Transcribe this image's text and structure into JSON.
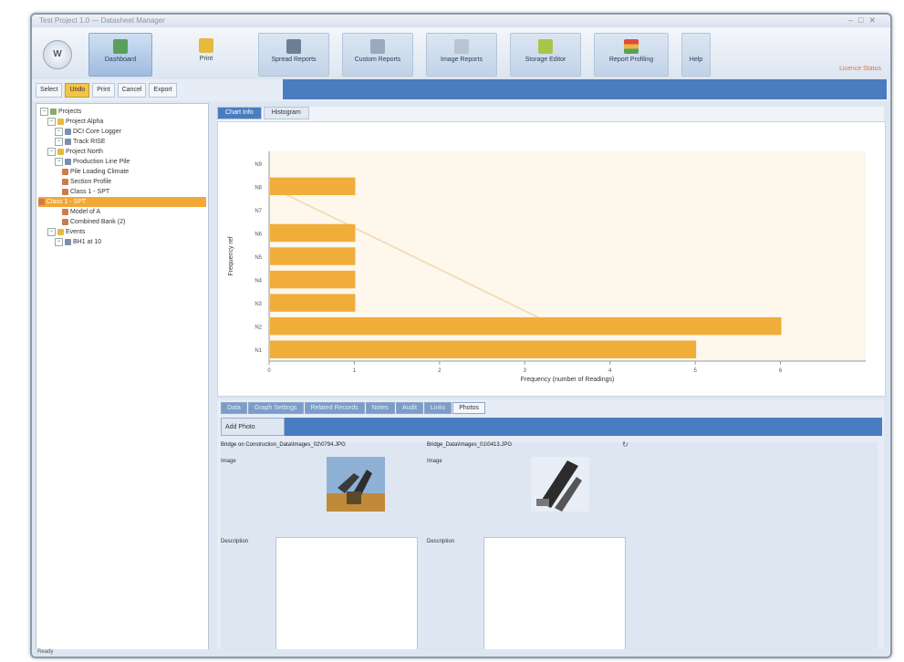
{
  "window": {
    "title": "Test Project 1.0 — Datasheet Manager"
  },
  "ribbon": {
    "app_button": "W",
    "buttons": [
      {
        "label": "Dashboard",
        "icon": "dashboard-icon"
      },
      {
        "label": "Print",
        "icon": "print-icon"
      },
      {
        "label": "Spread Reports",
        "icon": "reports-icon"
      },
      {
        "label": "Custom Reports",
        "icon": "custom-reports-icon"
      },
      {
        "label": "Image Reports",
        "icon": "image-reports-icon"
      },
      {
        "label": "Storage Editor",
        "icon": "storage-icon"
      },
      {
        "label": "Report Profiling",
        "icon": "profiling-icon"
      },
      {
        "label": "Help",
        "icon": "help-icon"
      }
    ],
    "right_text": "Licence Status"
  },
  "toolbar": {
    "items": [
      "Select",
      "Undo",
      "Print",
      "Cancel",
      "Export"
    ]
  },
  "tree": {
    "nodes": [
      {
        "label": "Projects",
        "level": 0
      },
      {
        "label": "Project Alpha",
        "level": 1
      },
      {
        "label": "DCI Core Logger",
        "level": 2
      },
      {
        "label": "Track RISE",
        "level": 2
      },
      {
        "label": "Project North",
        "level": 1
      },
      {
        "label": "Production Line Pile",
        "level": 2
      },
      {
        "label": "Pile Loading Climate",
        "level": 3
      },
      {
        "label": "Section Profile",
        "level": 3
      },
      {
        "label": "Class 1 - SPT",
        "level": 3
      },
      {
        "label": "Class 1 - SPT",
        "level": 3,
        "selected": true
      },
      {
        "label": "Model of A",
        "level": 3
      },
      {
        "label": "Combined Bank (2)",
        "level": 3
      },
      {
        "label": "Events",
        "level": 1
      },
      {
        "label": "BH1 at 10",
        "level": 2
      }
    ]
  },
  "chart_tabs": [
    "Chart Info",
    "Histogram"
  ],
  "chart_data": {
    "type": "bar",
    "orientation": "horizontal",
    "categories": [
      "N1",
      "N2",
      "N3",
      "N4",
      "N5",
      "N6",
      "N7",
      "N8",
      "N9"
    ],
    "values": [
      5,
      6,
      1,
      1,
      1,
      1,
      0,
      1,
      0
    ],
    "xlabel": "Frequency (number of Readings)",
    "ylabel": "Frequency ref",
    "xlim": [
      0,
      7
    ],
    "xticks": [
      "0",
      "1",
      "2",
      "3",
      "4",
      "5",
      "6"
    ],
    "bar_color": "#f0ad3a",
    "trend_color": "#f0d8a8",
    "grid": false
  },
  "lower": {
    "tabs": [
      "Data",
      "Graph Settings",
      "Related Records",
      "Notes",
      "Audit",
      "Links",
      "Photos"
    ],
    "active_tab": "Photos",
    "photos_button": "Add Photo",
    "files": [
      "Bridge on Construction_Data\\Images_02\\0794.JPG",
      "Bridge_Data\\Images_01\\0413.JPG"
    ],
    "image_label": "Image",
    "desc_label": "Description"
  },
  "status": {
    "text": "Ready"
  }
}
